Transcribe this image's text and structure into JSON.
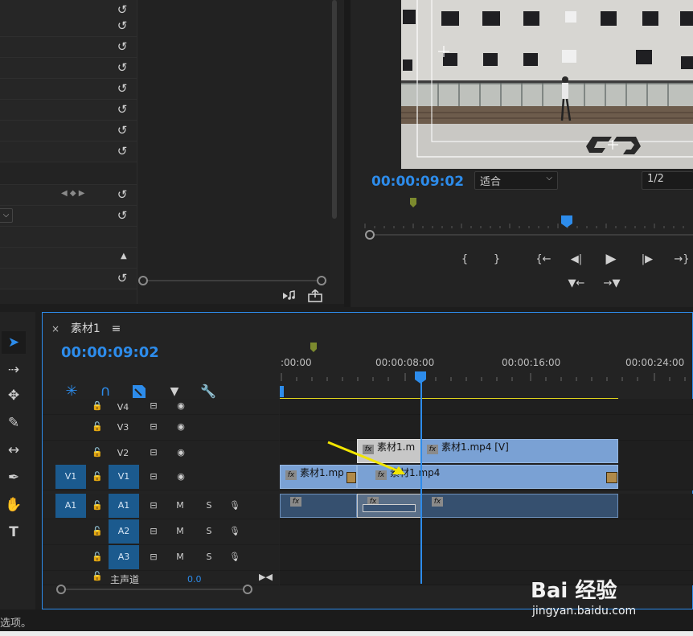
{
  "effect_controls": {
    "reset_rows": 8,
    "keyframe_nav": "◀ ◆ ▶",
    "dropdown_arrow": "⌵",
    "collapse_arrow": "▲",
    "reset_icon": "↺"
  },
  "program_monitor": {
    "timecode": "00:00:09:02",
    "fit_label": "适合",
    "fit_caret": "⌵",
    "resolution": "1/2",
    "controls": {
      "mark_in": "{",
      "mark_out": "}",
      "go_to_in": "{←",
      "step_back": "◀|",
      "play": "▶",
      "step_forward": "|▶",
      "go_to_out": "→}",
      "lift": "▼←",
      "extract": "→▼"
    },
    "export_icons": [
      "speaker-note-icon",
      "export-frame-icon"
    ]
  },
  "timeline": {
    "tab_title": "素材1",
    "menu_icon": "≡",
    "close_icon": "×",
    "timecode": "00:00:09:02",
    "ruler_labels": [
      ":00:00",
      "00:00:08:00",
      "00:00:16:00",
      "00:00:24:00"
    ],
    "tracks_video": [
      {
        "label": "V4",
        "source": "",
        "target": false
      },
      {
        "label": "V3",
        "source": "",
        "target": false
      },
      {
        "label": "V2",
        "source": "",
        "target": false
      },
      {
        "label": "V1",
        "source": "V1",
        "target": true
      }
    ],
    "tracks_audio": [
      {
        "label": "A1",
        "source": "A1",
        "target": true
      },
      {
        "label": "A2",
        "source": "",
        "target": false
      },
      {
        "label": "A3",
        "source": "",
        "target": false
      }
    ],
    "audio_buttons": {
      "mute": "M",
      "solo": "S"
    },
    "master": {
      "label": "主声道",
      "value": "0.0"
    },
    "clips": {
      "v2_a": "素材1.m",
      "v2_b": "素材1.mp4 [V]",
      "v1_a": "素材1.mp",
      "v1_b": "素材1.mp4"
    }
  },
  "status": {
    "text": "选项。"
  },
  "watermark": {
    "brand": "Bai 经验",
    "url": "jingyan.baidu.com"
  },
  "colors": {
    "accent_blue": "#2d8ceb",
    "clip_blue": "#7aa1d4",
    "track_target": "#1b5a8e",
    "work_area_yellow": "#e3d61c",
    "annotation_arrow": "#f2e600"
  }
}
